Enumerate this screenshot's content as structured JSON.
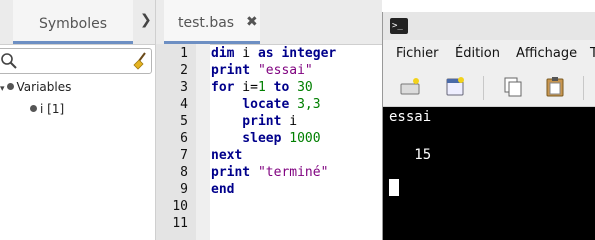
{
  "left_panel": {
    "tab_label": "Symboles",
    "tree": {
      "variables_label": "Variables",
      "item_label": "i [1]"
    }
  },
  "editor": {
    "tab_label": "test.bas",
    "tab_close": "✖",
    "line_numbers": [
      "1",
      "2",
      "3",
      "4",
      "5",
      "6",
      "7",
      "8",
      "9",
      "10",
      "11"
    ],
    "code": {
      "l1_kw1": "dim",
      "l1_id": " i ",
      "l1_kw2": "as integer",
      "l2_kw": "print",
      "l2_str": " \"essai\"",
      "l3_kw": "for",
      "l3_a": " i=",
      "l3_n1": "1",
      "l3_kw2": " to ",
      "l3_n2": "30",
      "l4_kw": "    locate",
      "l4_n": " 3,3",
      "l5_kw": "    print",
      "l5_id": " i",
      "l6_kw": "    sleep",
      "l6_n": " 1000",
      "l7_kw": "next",
      "l8_kw": "print",
      "l8_str": " \"terminé\"",
      "l9_kw": "end"
    }
  },
  "terminal": {
    "icon_text": ">_",
    "menu": [
      "Fichier",
      "Édition",
      "Affichage",
      "T"
    ],
    "output": [
      "essai",
      "",
      "   15"
    ]
  }
}
